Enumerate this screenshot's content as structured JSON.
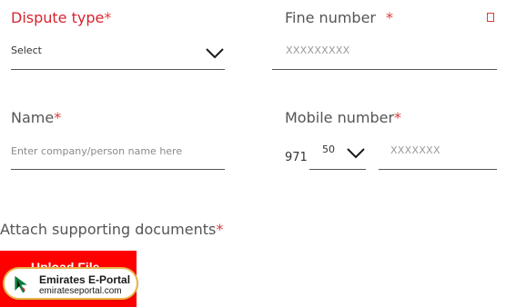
{
  "form": {
    "dispute_type": {
      "label": "Dispute type",
      "required_mark": "*",
      "value": "Select",
      "icon": "chevron-down-icon"
    },
    "fine_number": {
      "label": "Fine number",
      "required_mark": "*",
      "placeholder": "XXXXXXXXX"
    },
    "name": {
      "label": "Name",
      "required_mark": "*",
      "placeholder": "Enter company/person name here"
    },
    "mobile_number": {
      "label": "Mobile number",
      "required_mark": "*",
      "country_code": "971",
      "prefix_value": "50",
      "placeholder": "XXXXXXX"
    },
    "attachments": {
      "label": "Attach supporting documents",
      "required_mark": "*",
      "upload_label": "Upload File"
    }
  },
  "watermark": {
    "title": "Emirates E-Portal",
    "url": "emirateseportal.com"
  },
  "colors": {
    "accent_red": "#d9232d",
    "button_red": "#ff0000",
    "badge_border": "#e8b64a"
  }
}
